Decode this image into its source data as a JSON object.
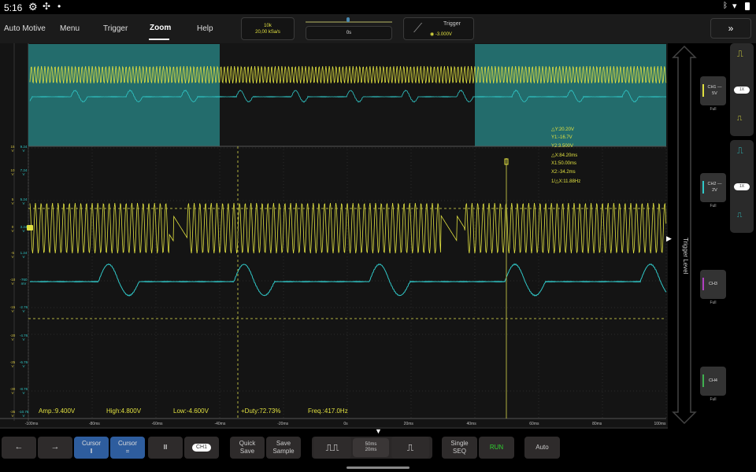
{
  "status": {
    "time": "5:16"
  },
  "menu": [
    {
      "label": "Auto Motive"
    },
    {
      "label": "Menu"
    },
    {
      "label": "Trigger"
    },
    {
      "label": "Zoom"
    },
    {
      "label": "Help"
    }
  ],
  "active_menu": "Zoom",
  "sampling": {
    "points": "10k",
    "rate": "20,00 kSa/s"
  },
  "timebase": {
    "offset": "0s"
  },
  "trigger": {
    "title": "Trigger",
    "level": "-3.000V"
  },
  "cursor_readout": [
    "△Y:20.20V",
    "Y1:-16.7V",
    "Y2:3.500V",
    "△X:84.20ms",
    "X1:50.00ms",
    "X2:-34.2ms",
    "1/△X:11.88Hz"
  ],
  "measurements": {
    "amp": "Amp.:9.400V",
    "high": "High:4.800V",
    "low": "Low:-4.600V",
    "duty": "+Duty:72.73%",
    "freq": "Freq.:417.0Hz"
  },
  "ch1_axis": [
    "15 V",
    "10 V",
    "5 V",
    "0 V",
    "-5 V",
    "-10 V",
    "-15 V",
    "-20 V",
    "-25 V",
    "-30 V",
    "-35 V"
  ],
  "ch2_axis": [
    "9.24 V",
    "7.24 V",
    "5.24 V",
    "3.24 V",
    "1.24 V",
    "-760 mV",
    "-2.76 V",
    "-4.76 V",
    "-6.76 V",
    "-8.76 V",
    "-10.76 V"
  ],
  "time_axis": [
    "-100ms",
    "-80ms",
    "-60ms",
    "-40ms",
    "-20ms",
    "0s",
    "20ms",
    "40ms",
    "60ms",
    "80ms",
    "100ms"
  ],
  "trigger_level_label": "Trigger Level",
  "channels": [
    {
      "label": "CH1 — 5V",
      "mode": "Full",
      "color": "#e0e040",
      "probe": "1X"
    },
    {
      "label": "CH2 — 2V",
      "mode": "Full",
      "color": "#30c8c8",
      "probe": "1X"
    },
    {
      "label": "CH3",
      "mode": "Full",
      "color": "#b040c0"
    },
    {
      "label": "CH4",
      "mode": "Full",
      "color": "#40b050"
    }
  ],
  "toolbar": {
    "left": "←",
    "right": "→",
    "cursor_v": "Cursor",
    "cursor_v_sym": "‖",
    "cursor_h": "Cursor",
    "cursor_h_sym": "=",
    "cursor_off": "Ⅲ",
    "ch_select": "CH1",
    "quick_save": "Quick Save",
    "save_sample": "Save Sample",
    "zoom_out_sym": "⎍⎍",
    "timebase_main": "50ms",
    "timebase_zoom": "20ms",
    "zoom_in_sym": "⎍",
    "single": "Single SEQ",
    "run": "RUN",
    "auto": "Auto"
  },
  "colors": {
    "ch1": "#e0e040",
    "ch2": "#30c8c8",
    "run": "#30d030",
    "cursor_button": "#2e5d9e"
  }
}
